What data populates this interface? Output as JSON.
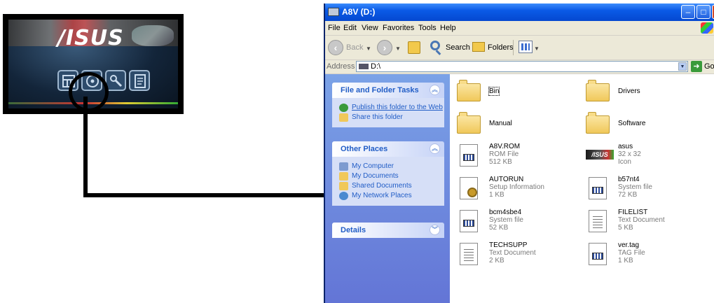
{
  "launcher": {
    "brand": "/ISUS"
  },
  "window": {
    "title": "A8V (D:)",
    "menu": [
      "File",
      "Edit",
      "View",
      "Favorites",
      "Tools",
      "Help"
    ],
    "toolbar": {
      "back": "Back",
      "search": "Search",
      "folders": "Folders"
    },
    "address": {
      "label": "Address",
      "value": "D:\\",
      "go": "Go"
    }
  },
  "tasks": {
    "file_folder": {
      "title": "File and Folder Tasks",
      "items": [
        "Publish this folder to the Web",
        "Share this folder"
      ]
    },
    "other_places": {
      "title": "Other Places",
      "items": [
        "My Computer",
        "My Documents",
        "Shared Documents",
        "My Network Places"
      ]
    },
    "details": {
      "title": "Details"
    }
  },
  "files": [
    {
      "name": "Bin",
      "kind": "folder"
    },
    {
      "name": "Drivers",
      "kind": "folder"
    },
    {
      "name": "Manual",
      "kind": "folder"
    },
    {
      "name": "Software",
      "kind": "folder"
    },
    {
      "name": "A8V.ROM",
      "type": "ROM File",
      "size": "512 KB",
      "kind": "sys"
    },
    {
      "name": "asus",
      "type": "32 x 32",
      "size": "Icon",
      "kind": "asus"
    },
    {
      "name": "AUTORUN",
      "type": "Setup Information",
      "size": "1 KB",
      "kind": "setup"
    },
    {
      "name": "b57nt4",
      "type": "System file",
      "size": "72 KB",
      "kind": "sys"
    },
    {
      "name": "bcm4sbe4",
      "type": "System file",
      "size": "52 KB",
      "kind": "sys"
    },
    {
      "name": "FILELIST",
      "type": "Text Document",
      "size": "5 KB",
      "kind": "txt"
    },
    {
      "name": "TECHSUPP",
      "type": "Text Document",
      "size": "2 KB",
      "kind": "txt"
    },
    {
      "name": "ver.tag",
      "type": "TAG File",
      "size": "1 KB",
      "kind": "sys"
    }
  ]
}
